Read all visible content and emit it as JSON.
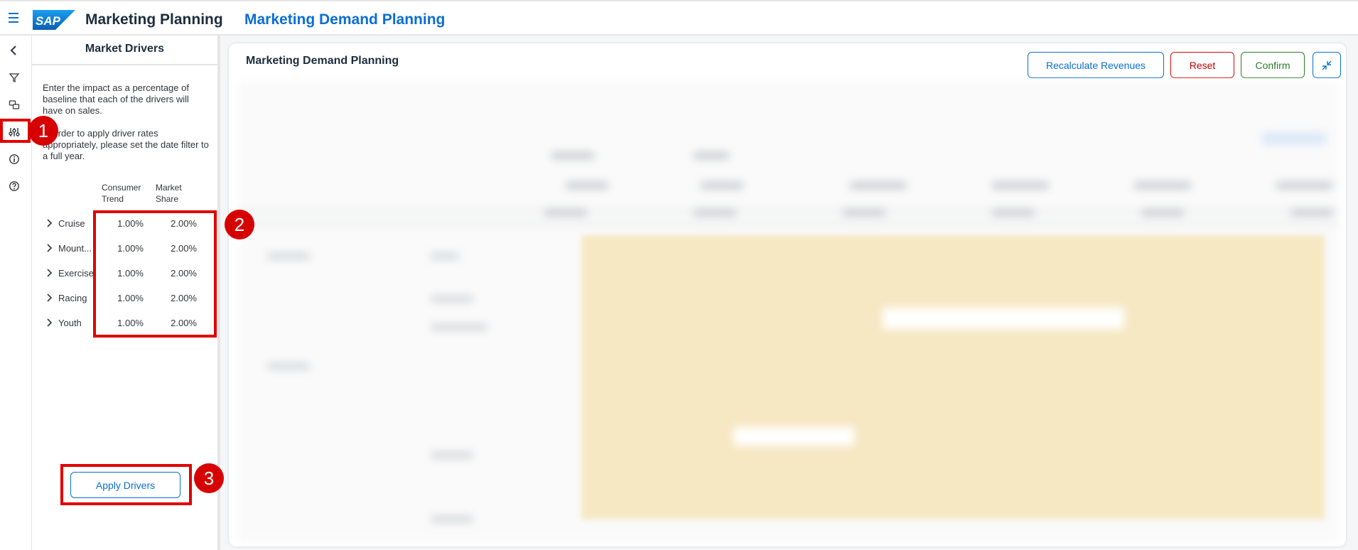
{
  "shell": {
    "app_title": "Marketing Planning",
    "page_title": "Marketing Demand Planning",
    "logo_text": "SAP"
  },
  "rail": {
    "icons": [
      "back-icon",
      "filter-icon",
      "comments-icon",
      "sliders-icon",
      "info-icon",
      "help-icon"
    ]
  },
  "panel": {
    "title": "Market Drivers",
    "description_1": "Enter the impact as a percentage of baseline that each of the drivers will have on sales.",
    "description_2": "In order to apply driver rates appropriately, please set the date filter to a full year.",
    "col1_header": "Consumer Trend",
    "col2_header": "Market Share",
    "drivers": [
      {
        "name": "Cruise",
        "consumer_trend": "1.00%",
        "market_share": "2.00%"
      },
      {
        "name": "Mount...",
        "consumer_trend": "1.00%",
        "market_share": "2.00%"
      },
      {
        "name": "Exercise",
        "consumer_trend": "1.00%",
        "market_share": "2.00%"
      },
      {
        "name": "Racing",
        "consumer_trend": "1.00%",
        "market_share": "2.00%"
      },
      {
        "name": "Youth",
        "consumer_trend": "1.00%",
        "market_share": "2.00%"
      }
    ],
    "apply_label": "Apply Drivers"
  },
  "card": {
    "title": "Marketing Demand Planning",
    "recalc_label": "Recalculate Revenues",
    "reset_label": "Reset",
    "confirm_label": "Confirm"
  },
  "annotations": {
    "badge_1": "1",
    "badge_2": "2",
    "badge_3": "3"
  },
  "colors": {
    "accent": "#0a6ed1",
    "annotation": "#e00000",
    "reset": "#c00000",
    "confirm": "#2b7c2b",
    "highlight_cells": "#f6e8c3"
  }
}
